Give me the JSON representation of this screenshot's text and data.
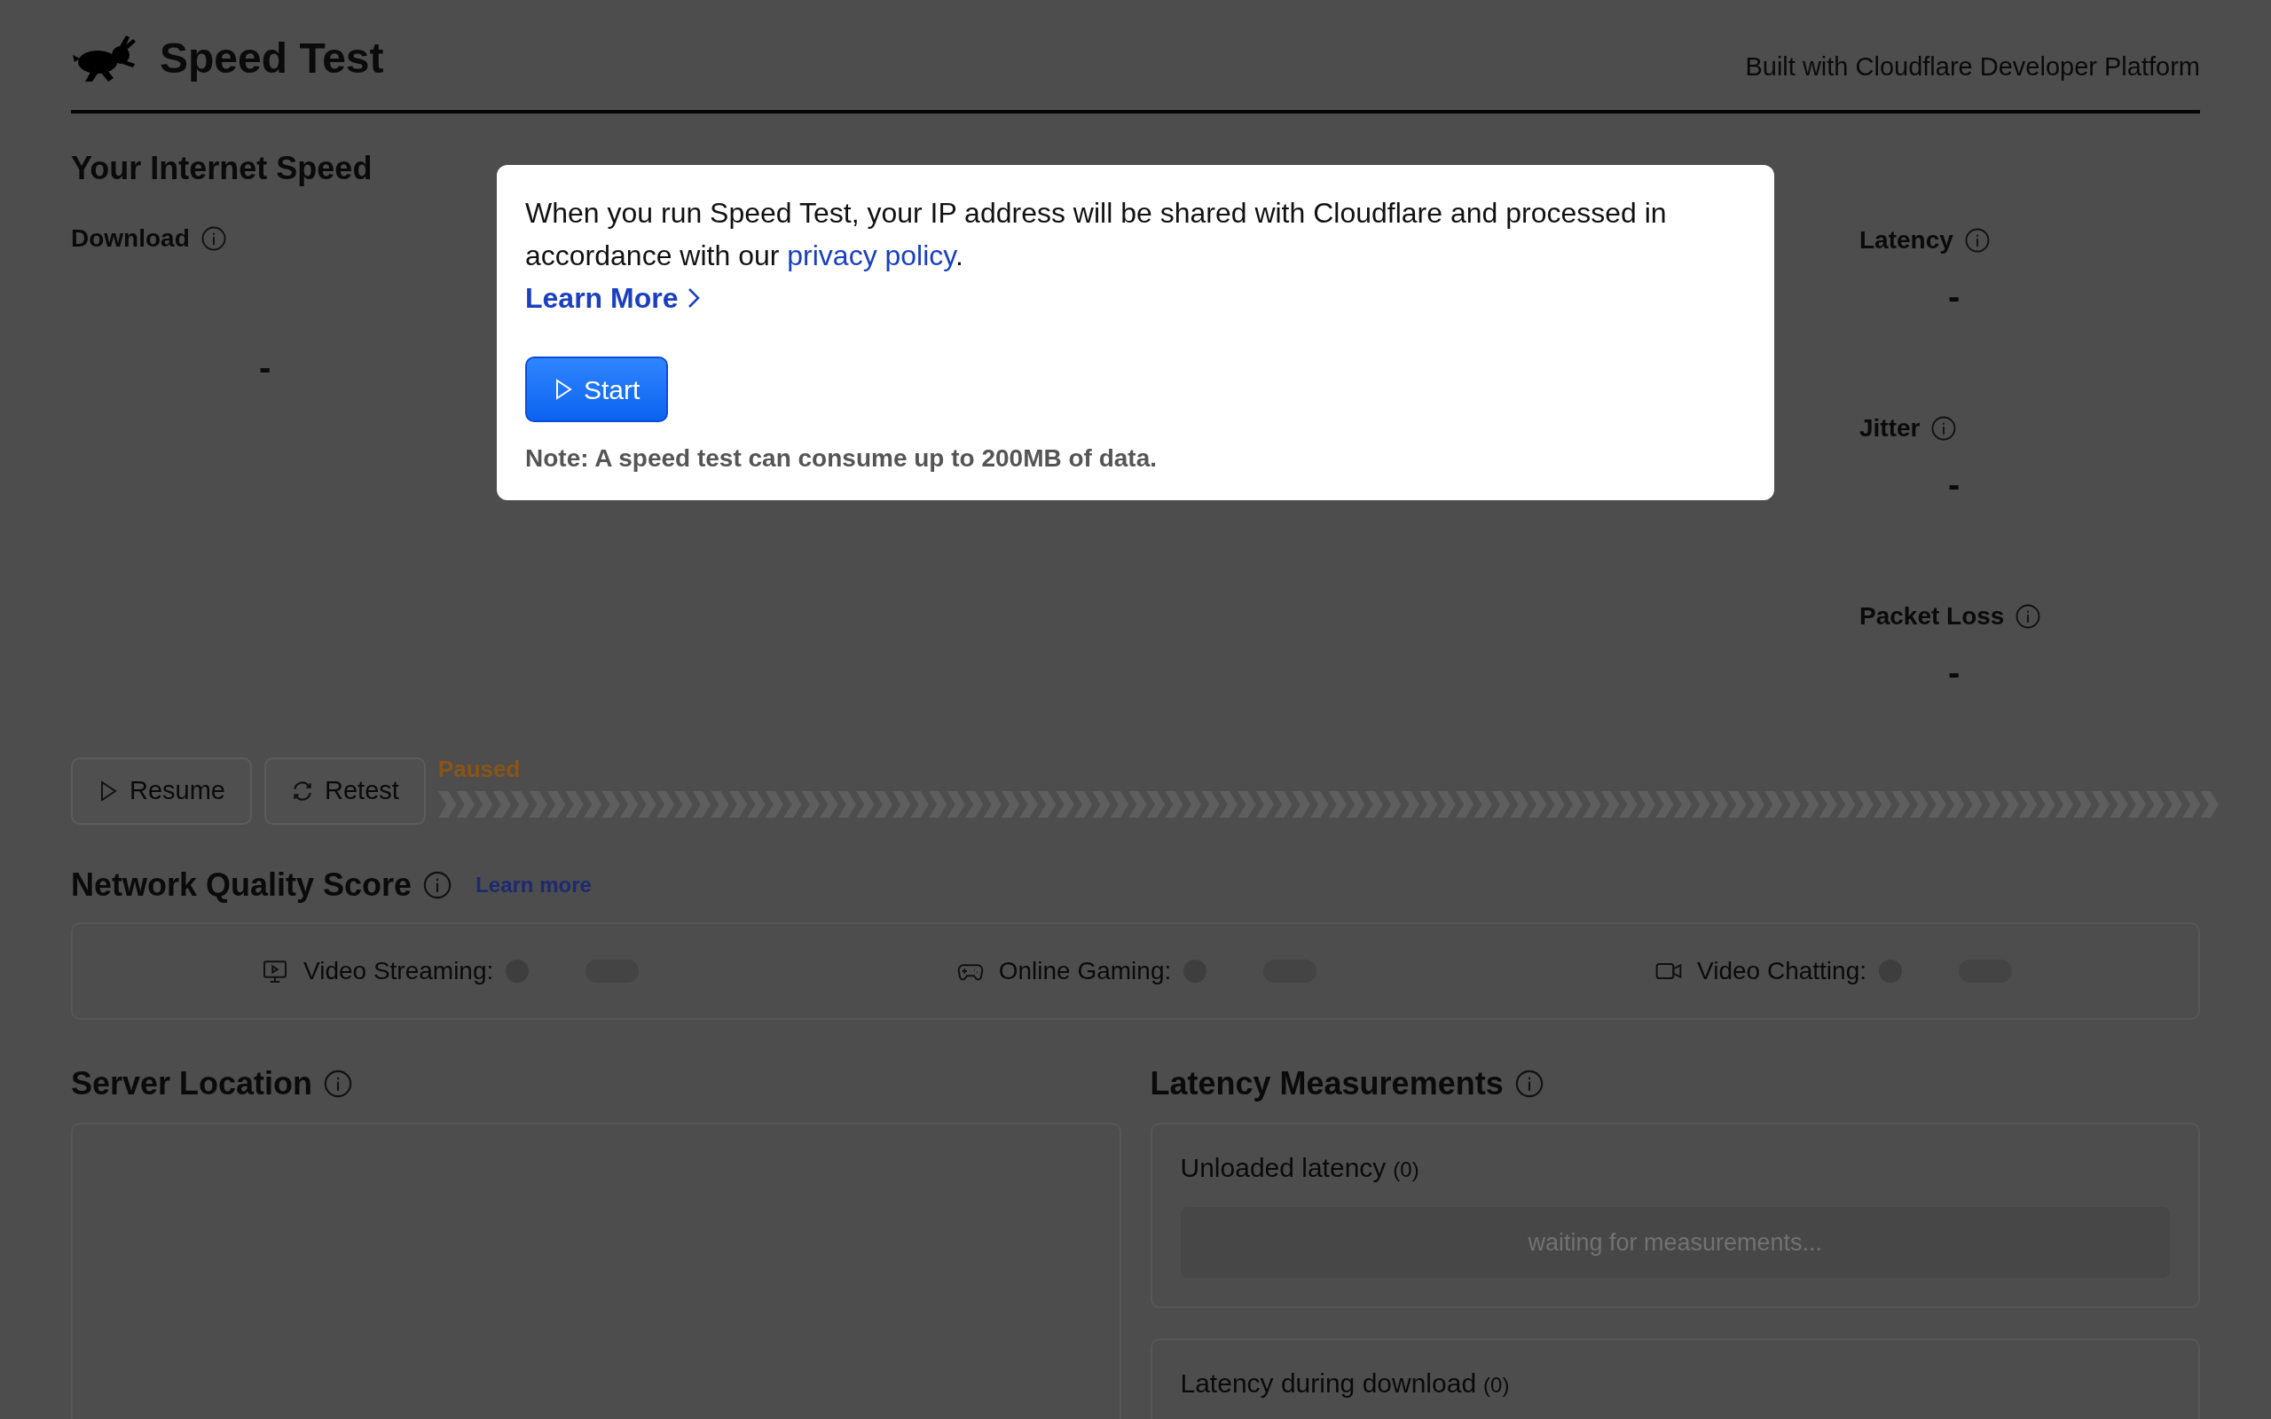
{
  "header": {
    "title": "Speed Test",
    "credit": "Built with Cloudflare Developer Platform"
  },
  "internet_speed": {
    "title": "Your Internet Speed",
    "download": {
      "label": "Download",
      "value": "-"
    },
    "metrics": [
      {
        "label": "Latency",
        "value": "-"
      },
      {
        "label": "Jitter",
        "value": "-"
      },
      {
        "label": "Packet Loss",
        "value": "-"
      }
    ]
  },
  "controls": {
    "buttons": [
      "Resume",
      "Retest"
    ],
    "status": "Paused"
  },
  "quality": {
    "title": "Network Quality Score",
    "link": "Learn more",
    "items": [
      "Video Streaming:",
      "Online Gaming:",
      "Video Chatting:"
    ]
  },
  "server_location": {
    "title": "Server Location"
  },
  "latency_measurements": {
    "title": "Latency Measurements",
    "panels": [
      {
        "label": "Unloaded latency",
        "count": "(0)",
        "placeholder": "waiting for measurements..."
      },
      {
        "label": "Latency during download",
        "count": "(0)"
      }
    ]
  },
  "dialog": {
    "text_before": "When you run Speed Test, your IP address will be shared with Cloudflare and processed in accordance with our ",
    "link": "privacy policy",
    "text_after": ".",
    "learn_more": "Learn More",
    "start": "Start",
    "note": "Note: A speed test can consume up to 200MB of data."
  }
}
